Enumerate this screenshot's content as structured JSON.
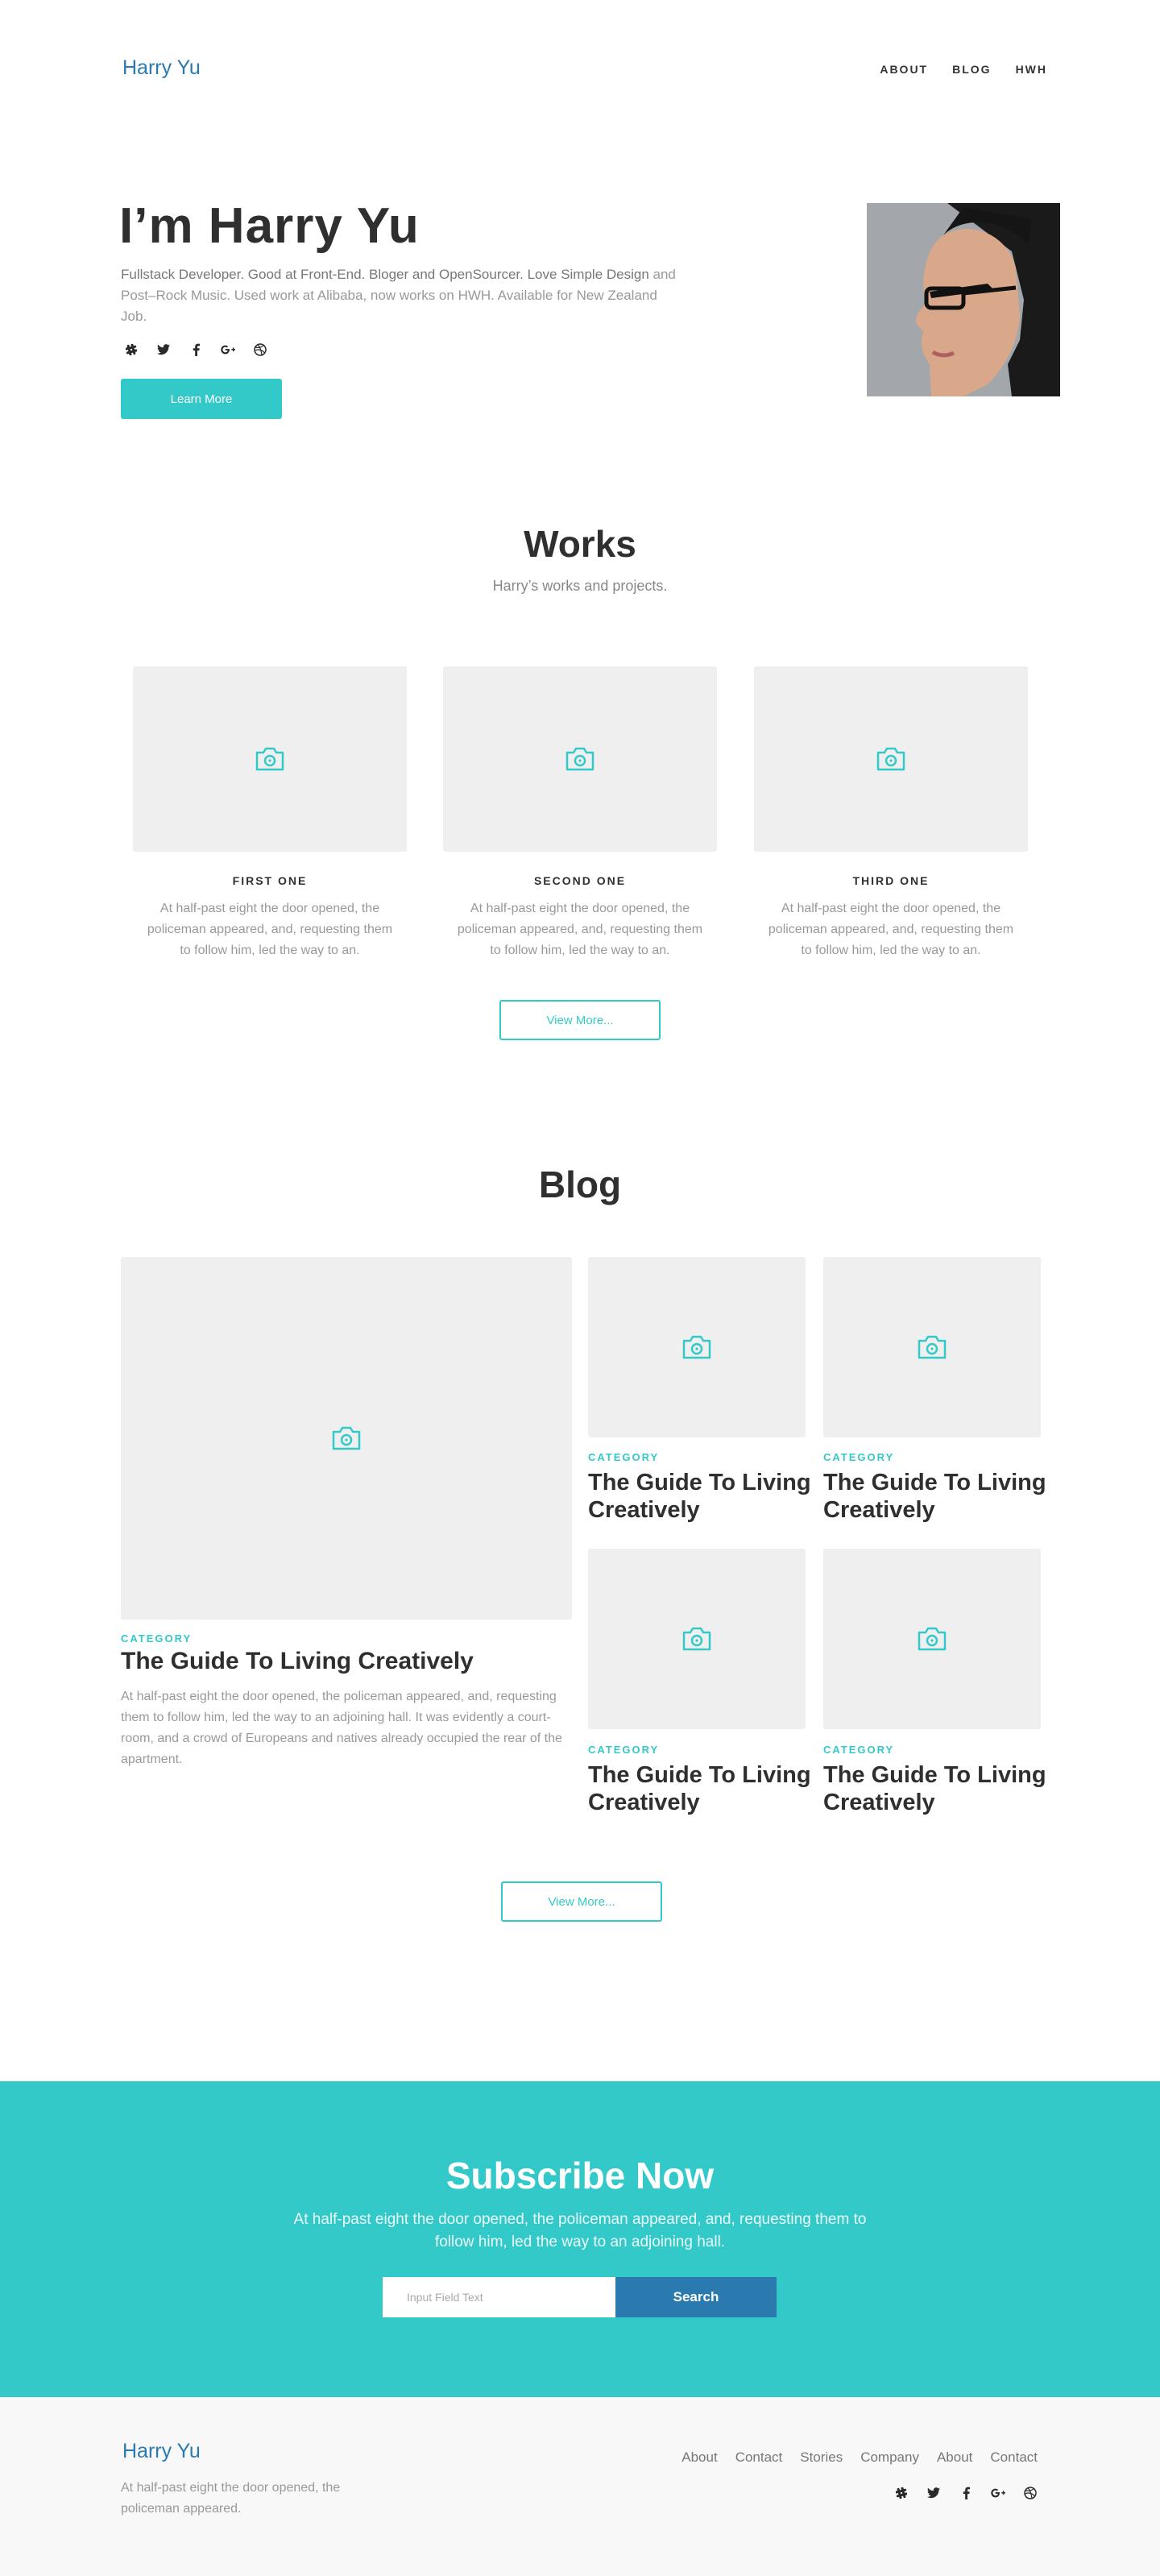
{
  "header": {
    "logo": "Harry Yu",
    "nav": [
      "ABOUT",
      "BLOG",
      "HWH"
    ]
  },
  "hero": {
    "title": "I’m Harry Yu",
    "desc_strong": "Fullstack Developer. Good at Front-End. Bloger and OpenSourcer. Love Simple Design",
    "desc_rest": " and Post–Rock Music. Used work at Alibaba, now works on HWH. Available for New Zealand Job.",
    "social_icons": [
      "slack-icon",
      "twitter-icon",
      "facebook-icon",
      "google-plus-icon",
      "dribbble-icon"
    ],
    "button": "Learn More"
  },
  "works": {
    "title": "Works",
    "subtitle": "Harry’s works and projects.",
    "items": [
      {
        "name": "FIRST ONE",
        "desc": "At half-past eight the door opened, the policeman appeared, and, requesting them to follow him, led the way to an."
      },
      {
        "name": "SECOND ONE",
        "desc": "At half-past eight the door opened, the policeman appeared, and, requesting them to follow him, led the way to an."
      },
      {
        "name": "THIRD ONE",
        "desc": "At half-past eight the door opened, the policeman appeared, and, requesting them to follow him, led the way to an."
      }
    ],
    "button": "View More..."
  },
  "blog": {
    "title": "Blog",
    "featured": {
      "category": "CATEGORY",
      "title": "The Guide To Living Creatively",
      "excerpt": "At half-past eight the door opened, the policeman appeared, and, requesting them to follow him, led the way to an adjoining hall. It was evidently a court-room, and a crowd of Europeans and natives already occupied the rear of the apartment."
    },
    "posts": [
      {
        "category": "CATEGORY",
        "title": "The Guide To Living Creatively"
      },
      {
        "category": "CATEGORY",
        "title": "The Guide To Living Creatively"
      },
      {
        "category": "CATEGORY",
        "title": "The Guide To Living Creatively"
      },
      {
        "category": "CATEGORY",
        "title": "The Guide To Living Creatively"
      }
    ],
    "button": "View More..."
  },
  "subscribe": {
    "title": "Subscribe Now",
    "text": "At half-past eight the door opened, the policeman appeared, and, requesting them to follow him, led the way to an adjoining hall.",
    "placeholder": "Input Field Text",
    "button": "Search"
  },
  "footer": {
    "logo": "Harry Yu",
    "desc": "At half-past eight the door opened, the policeman appeared.",
    "links": [
      "About",
      "Contact",
      "Stories",
      "Company",
      "About",
      "Contact"
    ],
    "social_icons": [
      "slack-icon",
      "twitter-icon",
      "facebook-icon",
      "google-plus-icon",
      "dribbble-icon"
    ]
  },
  "colors": {
    "accent": "#33c9c9",
    "brand_blue": "#2a7ab0",
    "placeholder_bg": "#efefef"
  }
}
